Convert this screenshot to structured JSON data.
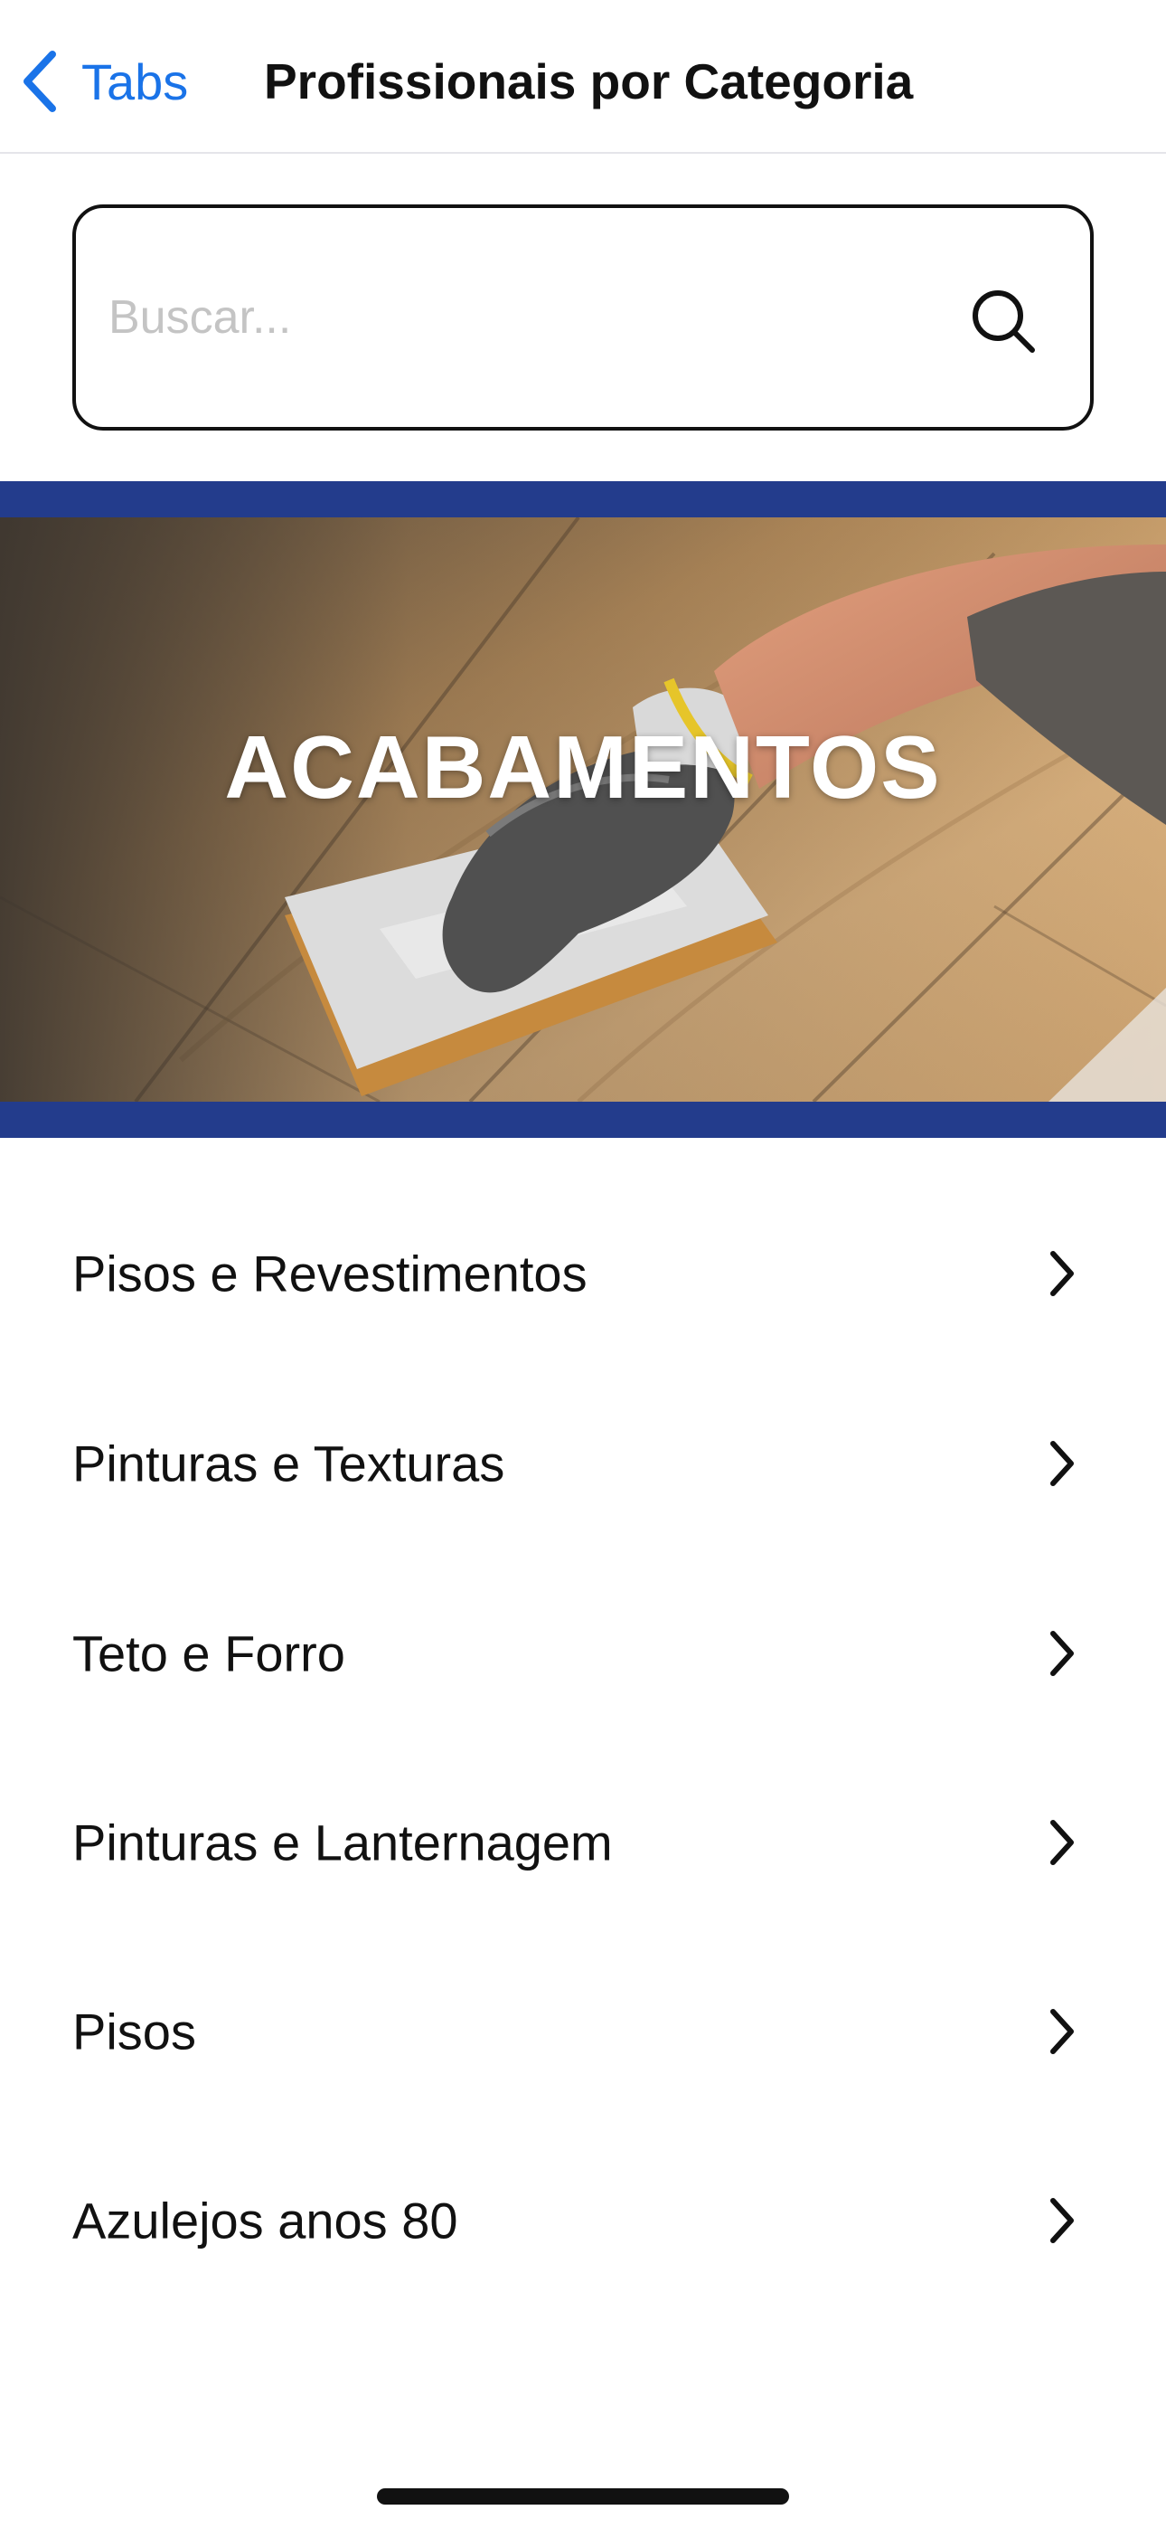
{
  "nav": {
    "back_label": "Tabs",
    "title": "Profissionais por Categoria"
  },
  "search": {
    "placeholder": "Buscar...",
    "value": ""
  },
  "banner": {
    "title": "ACABAMENTOS"
  },
  "categories": [
    {
      "label": "Pisos e Revestimentos"
    },
    {
      "label": "Pinturas e Texturas"
    },
    {
      "label": "Teto e Forro"
    },
    {
      "label": "Pinturas e Lanternagem"
    },
    {
      "label": "Pisos"
    },
    {
      "label": "Azulejos anos 80"
    }
  ],
  "colors": {
    "accent": "#1a73e8",
    "banner_stripe": "#233c8c",
    "text": "#111111"
  },
  "icons": {
    "back": "chevron-left-icon",
    "search": "search-icon",
    "row": "chevron-right-icon"
  }
}
